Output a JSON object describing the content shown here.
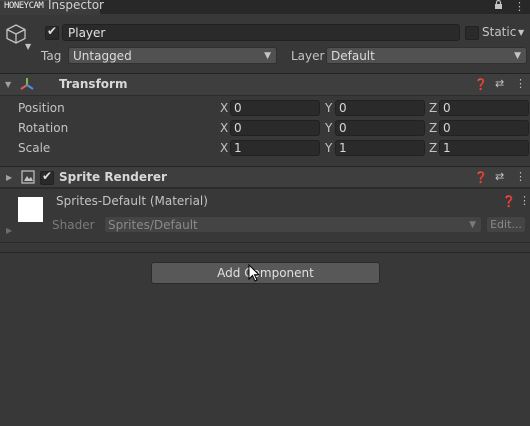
{
  "tab": {
    "title": "Inspector",
    "watermark": "HONEYCAM"
  },
  "header": {
    "name": "Player",
    "active": true,
    "static_label": "Static",
    "tag_label": "Tag",
    "tag_value": "Untagged",
    "layer_label": "Layer",
    "layer_value": "Default"
  },
  "transform": {
    "title": "Transform",
    "rows": [
      {
        "label": "Position",
        "x": "0",
        "y": "0",
        "z": "0"
      },
      {
        "label": "Rotation",
        "x": "0",
        "y": "0",
        "z": "0"
      },
      {
        "label": "Scale",
        "x": "1",
        "y": "1",
        "z": "1"
      }
    ],
    "axes": {
      "x": "X",
      "y": "Y",
      "z": "Z"
    }
  },
  "sprite_renderer": {
    "title": "Sprite Renderer",
    "enabled": true,
    "material_title": "Sprites-Default (Material)",
    "shader_label": "Shader",
    "shader_value": "Sprites/Default",
    "edit_label": "Edit..."
  },
  "add_component_label": "Add Component",
  "icons": {
    "lock": "lock-icon",
    "menu": "kebab-menu-icon",
    "help": "help-icon",
    "presets": "presets-icon",
    "gameobject": "cube-icon",
    "transform": "transform-icon",
    "sprite": "sprite-renderer-icon"
  }
}
